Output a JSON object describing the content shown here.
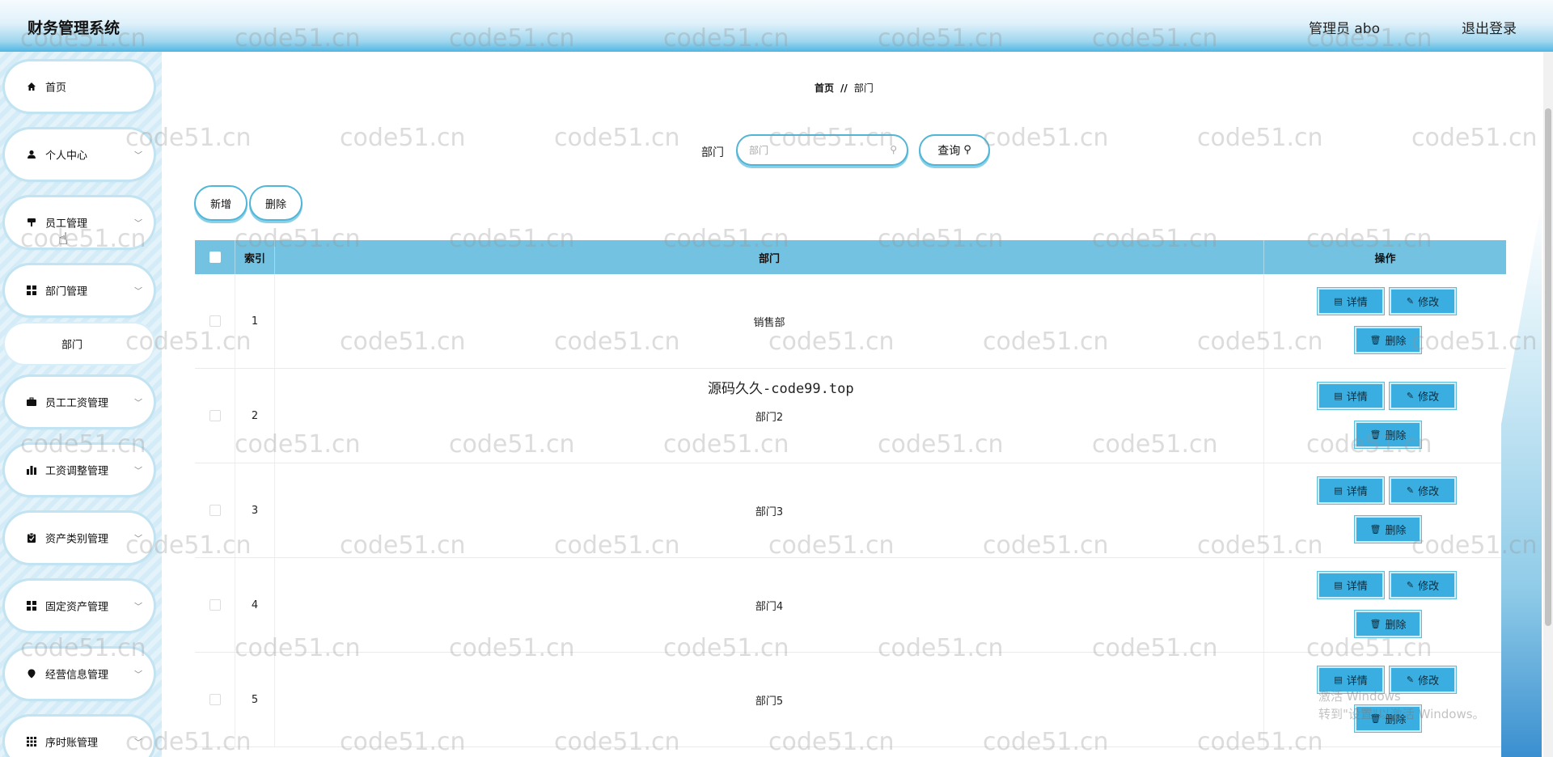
{
  "header": {
    "title": "财务管理系统",
    "user": "管理员 abo",
    "logout": "退出登录"
  },
  "sidebar": {
    "items": [
      {
        "label": "首页",
        "icon": "home-icon"
      },
      {
        "label": "个人中心",
        "icon": "user-icon"
      },
      {
        "label": "员工管理",
        "icon": "staff-icon"
      },
      {
        "label": "部门管理",
        "icon": "grid-icon"
      },
      {
        "label": "部门",
        "icon": ""
      },
      {
        "label": "员工工资管理",
        "icon": "briefcase-icon"
      },
      {
        "label": "工资调整管理",
        "icon": "bar-chart-icon"
      },
      {
        "label": "资产类别管理",
        "icon": "clipboard-icon"
      },
      {
        "label": "固定资产管理",
        "icon": "grid-icon"
      },
      {
        "label": "经营信息管理",
        "icon": "pin-icon"
      },
      {
        "label": "序时账管理",
        "icon": "grid-icon"
      }
    ]
  },
  "breadcrumb": {
    "home": "首页",
    "sep": "//",
    "current": "部门"
  },
  "search": {
    "label": "部门",
    "placeholder": "部门",
    "button": "查询"
  },
  "toolbar": {
    "add": "新增",
    "delete": "删除"
  },
  "table": {
    "headers": {
      "index": "索引",
      "dept": "部门",
      "ops": "操作"
    },
    "rows": [
      {
        "index": "1",
        "dept": "销售部"
      },
      {
        "index": "2",
        "dept": "部门2"
      },
      {
        "index": "3",
        "dept": "部门3"
      },
      {
        "index": "4",
        "dept": "部门4"
      },
      {
        "index": "5",
        "dept": "部门5"
      }
    ],
    "actions": {
      "detail": "详情",
      "edit": "修改",
      "delete": "删除"
    }
  },
  "watermark": "code51.cn",
  "source_text": "源码久久-code99.top",
  "windows_notice": {
    "line1": "激活 Windows",
    "line2": "转到\"设置\"以激活 Windows。"
  }
}
